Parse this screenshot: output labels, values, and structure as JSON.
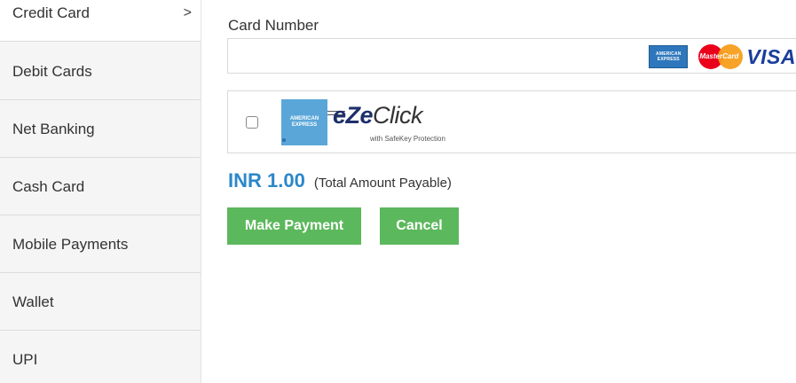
{
  "sidebar": {
    "items": [
      {
        "label": "Credit Card",
        "active": true,
        "chevron": ">"
      },
      {
        "label": "Debit Cards"
      },
      {
        "label": "Net Banking"
      },
      {
        "label": "Cash Card"
      },
      {
        "label": "Mobile Payments"
      },
      {
        "label": "Wallet"
      },
      {
        "label": "UPI"
      }
    ]
  },
  "card": {
    "label": "Card Number",
    "value": "",
    "logos": {
      "amex_line1": "AMERICAN",
      "amex_line2": "EXPRESS",
      "mastercard": "MasterCard",
      "visa": "VISA"
    }
  },
  "ezeclick": {
    "checked": false,
    "amex_line1": "AMERICAN",
    "amex_line2": "EXPRESS",
    "brand_e": "e",
    "brand_ze": "Ze",
    "brand_click": "Click",
    "subtitle": "with SafeKey Protection"
  },
  "payment": {
    "amount": "INR 1.00",
    "note": "(Total Amount Payable)"
  },
  "buttons": {
    "pay_label": "Make Payment",
    "cancel_label": "Cancel"
  },
  "colors": {
    "accent_blue": "#2b87c9",
    "button_green": "#5cb85c",
    "sidebar_bg": "#f5f5f5"
  }
}
